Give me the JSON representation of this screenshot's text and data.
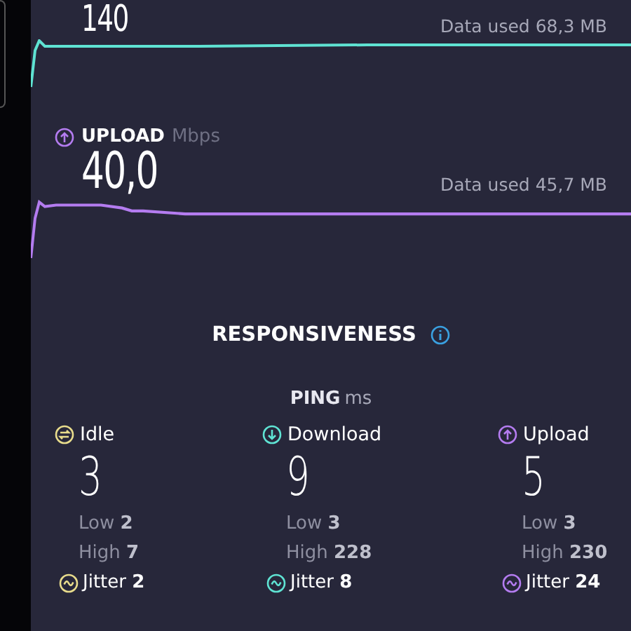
{
  "download": {
    "value": "140",
    "data_used": "Data used 68,3 MB"
  },
  "upload": {
    "label": "UPLOAD",
    "unit": "Mbps",
    "value": "40,0",
    "data_used": "Data used 45,7 MB"
  },
  "responsiveness": {
    "title": "RESPONSIVENESS"
  },
  "ping": {
    "label": "PING",
    "unit": "ms",
    "columns": [
      {
        "kind": "idle",
        "label": "Idle",
        "value": "3",
        "low": "Low **2**",
        "high": "High **7**",
        "jitter": "Jitter **2**",
        "color": "#e8dc8c"
      },
      {
        "kind": "download",
        "label": "Download",
        "value": "9",
        "low": "Low **3**",
        "high": "High **228**",
        "jitter": "Jitter **8**",
        "color": "#5fe3d3"
      },
      {
        "kind": "upload",
        "label": "Upload",
        "value": "5",
        "low": "Low **3**",
        "high": "High **230**",
        "jitter": "Jitter **24**",
        "color": "#b47cf0"
      }
    ]
  }
}
